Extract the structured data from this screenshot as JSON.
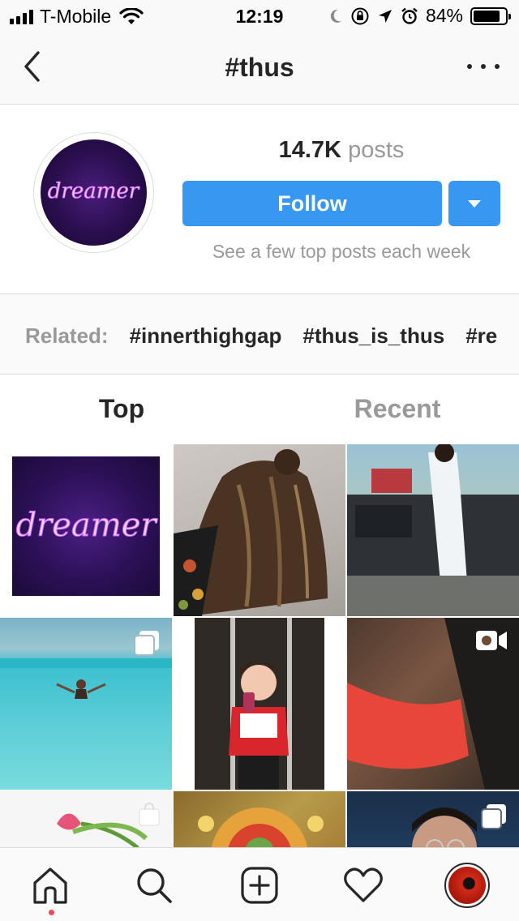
{
  "status_bar": {
    "carrier": "T-Mobile",
    "time": "12:19",
    "battery_percent": "84%",
    "battery_level": 0.84,
    "signal_bars": 4,
    "icons": [
      "wifi-icon",
      "moon-icon",
      "rotation-lock-icon",
      "location-arrow-icon",
      "alarm-icon",
      "battery-icon"
    ]
  },
  "header": {
    "title": "#thus",
    "icons": [
      "back-chevron-icon",
      "more-options-icon"
    ]
  },
  "profile": {
    "post_count": "14.7K",
    "post_label": "posts",
    "follow_label": "Follow",
    "subtitle": "See a few top posts each week",
    "avatar_text": "dreamer"
  },
  "related": {
    "label": "Related:",
    "tags": [
      "#innerthighgap",
      "#thus_is_thus",
      "#re"
    ]
  },
  "tabs": [
    {
      "label": "Top",
      "active": true
    },
    {
      "label": "Recent",
      "active": false
    }
  ],
  "grid": {
    "neon_text": "dreamer",
    "tiles": [
      {
        "desc": "neon-sign",
        "badge": null
      },
      {
        "desc": "hair",
        "badge": null
      },
      {
        "desc": "man-by-car",
        "badge": null
      },
      {
        "desc": "woman-in-sea",
        "badge": "carousel-icon"
      },
      {
        "desc": "mirror-selfie",
        "badge": null
      },
      {
        "desc": "swimwear",
        "badge": "video-icon"
      },
      {
        "desc": "tulip",
        "badge": "shopping-bag-icon"
      },
      {
        "desc": "painting",
        "badge": null
      },
      {
        "desc": "selfie",
        "badge": "carousel-icon"
      }
    ]
  },
  "tabbar": {
    "icons": [
      "home-icon",
      "search-icon",
      "add-post-icon",
      "heart-icon",
      "profile-avatar"
    ]
  },
  "colors": {
    "accent": "#3897f0",
    "text": "#262626",
    "muted": "#999999",
    "notification_dot": "#ed4956"
  }
}
